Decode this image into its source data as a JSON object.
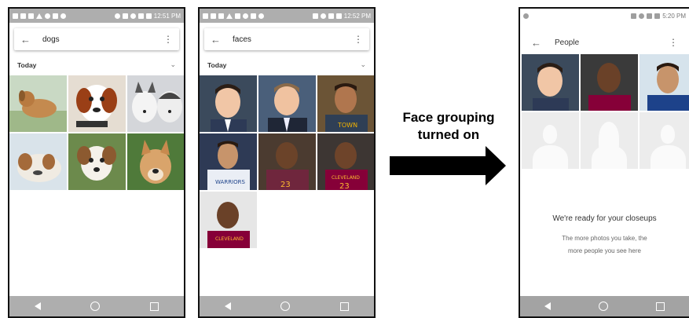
{
  "colors": {
    "status_bar": "#aeaeae",
    "nav_bar": "#aeaeae",
    "arrow": "#000000",
    "placeholder_bg": "#ececec"
  },
  "screen_dogs": {
    "status_time": "12:51 PM",
    "search_query": "dogs",
    "section_label": "Today",
    "photos": [
      "dog-photo-1",
      "dog-photo-2",
      "dog-photo-3",
      "dog-photo-4",
      "dog-photo-5",
      "dog-photo-6"
    ]
  },
  "screen_faces": {
    "status_time": "12:52 PM",
    "search_query": "faces",
    "section_label": "Today",
    "photos": [
      "face-photo-1",
      "face-photo-2",
      "face-photo-3",
      "face-photo-4",
      "face-photo-5",
      "face-photo-6",
      "face-photo-7"
    ]
  },
  "screen_people": {
    "status_time": "5:20 PM",
    "title": "People",
    "empty_title": "We're ready for your closeups",
    "empty_line1": "The more photos you take, the",
    "empty_line2": "more people you see here"
  },
  "caption": {
    "line1": "Face grouping",
    "line2": "turned on"
  },
  "icons": {
    "back": "arrow-left-icon",
    "menu": "more-vert-icon",
    "expand": "chevron-down-icon",
    "nav_back": "nav-back-icon",
    "nav_home": "nav-home-icon",
    "nav_recents": "nav-recents-icon"
  }
}
